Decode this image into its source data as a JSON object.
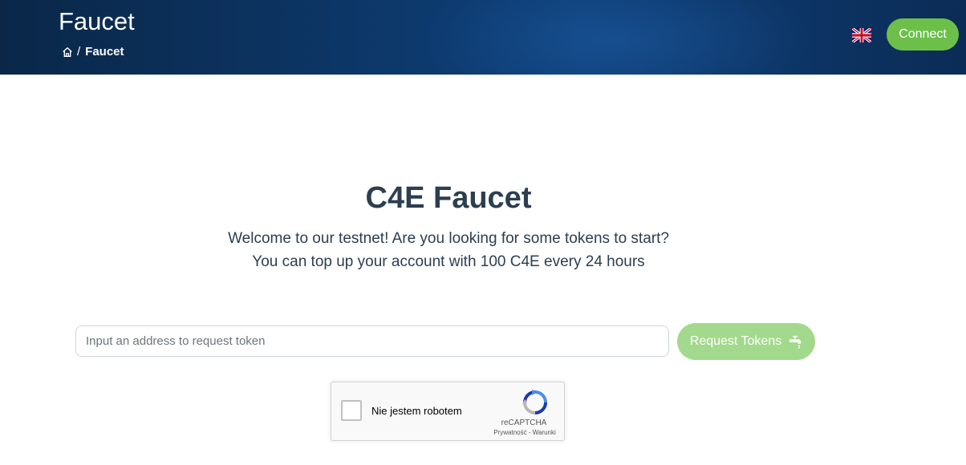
{
  "header": {
    "title": "Faucet",
    "breadcrumb": {
      "home_icon": "home-icon",
      "separator": "/",
      "current": "Faucet"
    },
    "language_flag": "uk-flag-icon",
    "connect_label": "Connect"
  },
  "main": {
    "title": "C4E Faucet",
    "welcome_line1": "Welcome to our testnet! Are you looking for some tokens to start?",
    "welcome_line2": "You can top up your account with 100 C4E every 24 hours",
    "address_input": {
      "value": "",
      "placeholder": "Input an address to request token"
    },
    "request_button_label": "Request Tokens",
    "request_button_icon": "faucet-tap-icon"
  },
  "recaptcha": {
    "label": "Nie jestem robotem",
    "brand": "reCAPTCHA",
    "links": "Prywatność - Warunki",
    "checked": false
  },
  "colors": {
    "header_bg": "#0d3a6e",
    "accent_green": "#6cc04a",
    "disabled_green": "#a3d98c",
    "title_text": "#2c3e50"
  }
}
